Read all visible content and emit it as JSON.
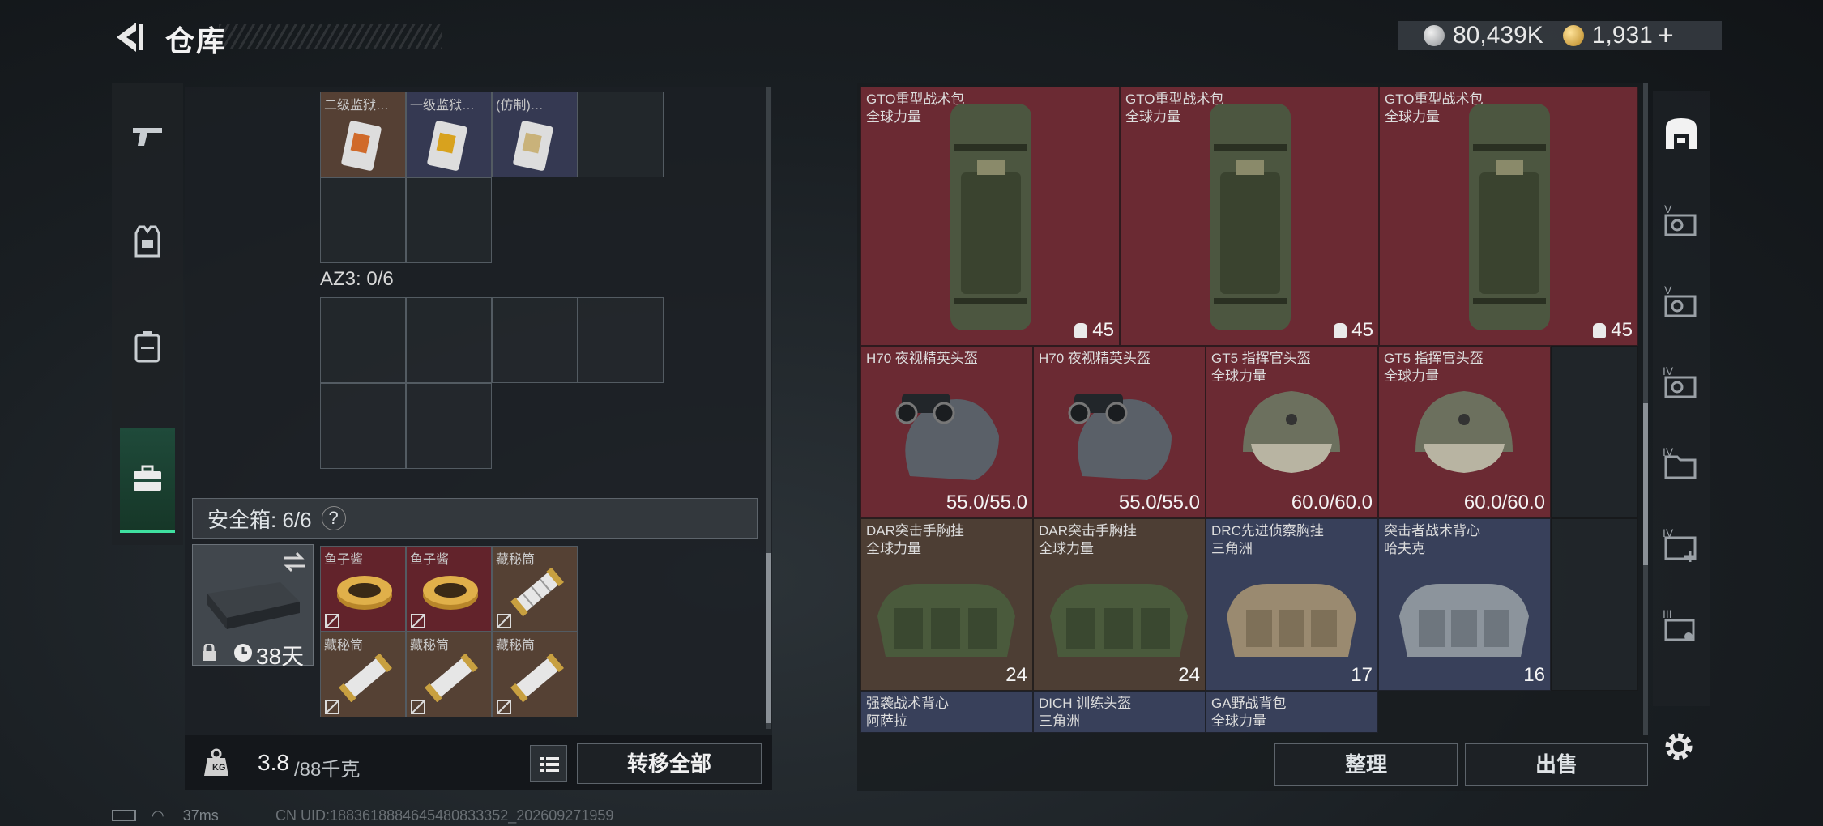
{
  "header": {
    "title": "仓库",
    "silver": "80,439K",
    "gold": "1,931",
    "gold_plus": "+"
  },
  "left": {
    "top_items": [
      {
        "label": "二级监狱…",
        "color": "brown"
      },
      {
        "label": "一级监狱…",
        "color": "blue"
      },
      {
        "label": "(仿制)…",
        "color": "blue"
      }
    ],
    "az3_label": "AZ3: 0/6",
    "safebox_label": "安全箱: 6/6",
    "safebox_help": "?",
    "safebox_days": "38天",
    "safe_items": [
      {
        "label": "鱼子酱",
        "color": "red"
      },
      {
        "label": "鱼子酱",
        "color": "red"
      },
      {
        "label": "藏秘筒",
        "color": "brown"
      },
      {
        "label": "藏秘筒",
        "color": "brown"
      },
      {
        "label": "藏秘筒",
        "color": "brown"
      },
      {
        "label": "藏秘筒",
        "color": "brown"
      }
    ],
    "weight_value": "3.8",
    "weight_unit": "/88千克",
    "kg_icon": "KG",
    "transfer_label": "转移全部"
  },
  "right": {
    "items": [
      {
        "name": "GTO重型战术包",
        "sub": "全球力量",
        "val": "45",
        "color": "red",
        "kind": "backpack"
      },
      {
        "name": "GTO重型战术包",
        "sub": "全球力量",
        "val": "45",
        "color": "red",
        "kind": "backpack"
      },
      {
        "name": "GTO重型战术包",
        "sub": "全球力量",
        "val": "45",
        "color": "red",
        "kind": "backpack"
      },
      {
        "name": "H70 夜视精英头盔",
        "sub": "",
        "val": "55.0/55.0",
        "color": "red",
        "kind": "helmet-nv"
      },
      {
        "name": "H70 夜视精英头盔",
        "sub": "",
        "val": "55.0/55.0",
        "color": "red",
        "kind": "helmet-nv"
      },
      {
        "name": "GT5 指挥官头盔",
        "sub": "全球力量",
        "val": "60.0/60.0",
        "color": "red",
        "kind": "helmet"
      },
      {
        "name": "GT5 指挥官头盔",
        "sub": "全球力量",
        "val": "60.0/60.0",
        "color": "red",
        "kind": "helmet"
      },
      {
        "name": "DAR突击手胸挂",
        "sub": "全球力量",
        "val": "24",
        "color": "brown",
        "kind": "rig-green"
      },
      {
        "name": "DAR突击手胸挂",
        "sub": "全球力量",
        "val": "24",
        "color": "brown",
        "kind": "rig-green"
      },
      {
        "name": "DRC先进侦察胸挂",
        "sub": "三角洲",
        "val": "17",
        "color": "blue",
        "kind": "rig-tan"
      },
      {
        "name": "突击者战术背心",
        "sub": "哈夫克",
        "val": "16",
        "color": "blue",
        "kind": "rig-grey"
      },
      {
        "name": "强袭战术背心",
        "sub": "阿萨拉",
        "val": "",
        "color": "blue",
        "kind": ""
      },
      {
        "name": "DICH 训练头盔",
        "sub": "三角洲",
        "val": "",
        "color": "blue",
        "kind": ""
      },
      {
        "name": "GA野战背包",
        "sub": "全球力量",
        "val": "",
        "color": "blue",
        "kind": ""
      }
    ],
    "tidy_label": "整理",
    "sell_label": "出售"
  },
  "right_sidebar": {
    "tab_labels": [
      "V",
      "V",
      "IV",
      "IV",
      "IV",
      "III"
    ]
  },
  "status": {
    "ping": "37ms",
    "uid": "CN UID:1883618884645480833352_202609271959"
  }
}
